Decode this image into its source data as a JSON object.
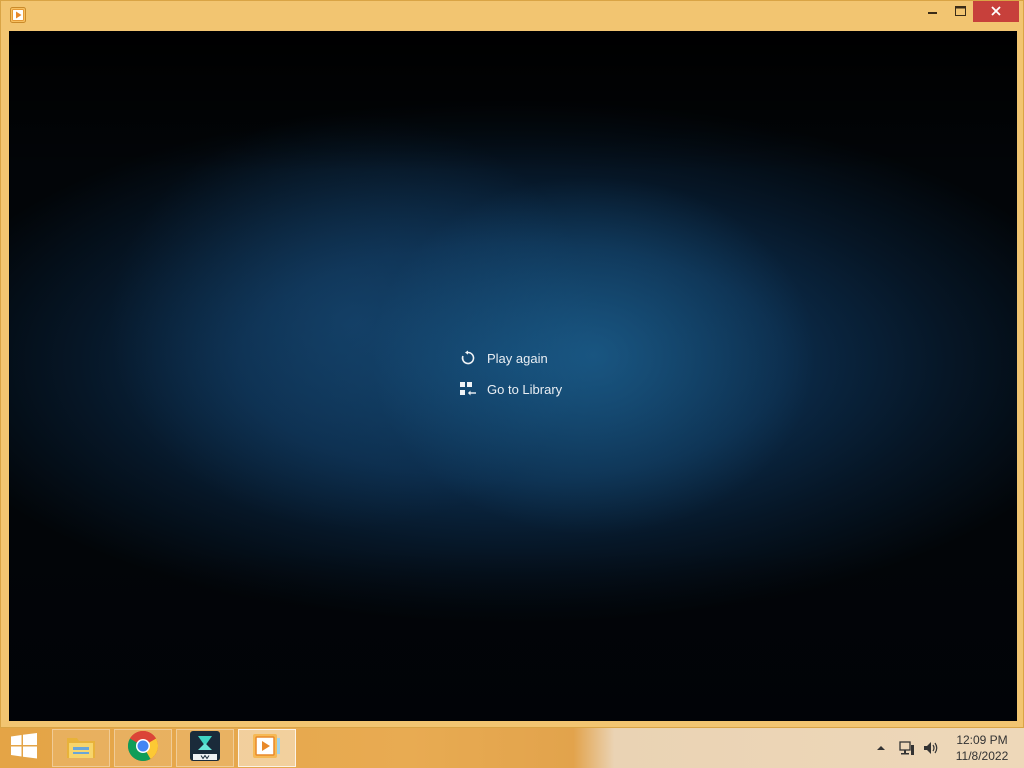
{
  "window": {
    "app_icon": "media-player-icon",
    "controls": {
      "minimize_icon": "minimize-icon",
      "maximize_icon": "maximize-icon",
      "close_icon": "close-icon"
    }
  },
  "player": {
    "menu": [
      {
        "label": "Play again",
        "icon": "replay-icon"
      },
      {
        "label": "Go to Library",
        "icon": "library-icon"
      }
    ]
  },
  "taskbar": {
    "start_icon": "windows-logo-icon",
    "apps": [
      {
        "name": "File Explorer",
        "icon": "file-explorer-icon"
      },
      {
        "name": "Google Chrome",
        "icon": "chrome-icon"
      },
      {
        "name": "Filmora",
        "icon": "filmora-icon"
      },
      {
        "name": "Media Player",
        "icon": "media-player-icon"
      }
    ],
    "tray": {
      "show_hidden_icon": "chevron-up-icon",
      "network_icon": "network-icon",
      "volume_icon": "volume-icon"
    },
    "clock": {
      "time": "12:09 PM",
      "date": "11/8/2022"
    }
  },
  "colors": {
    "frame": "#f2c571",
    "close_button": "#c7403b",
    "video_background": "#0b2a48"
  }
}
